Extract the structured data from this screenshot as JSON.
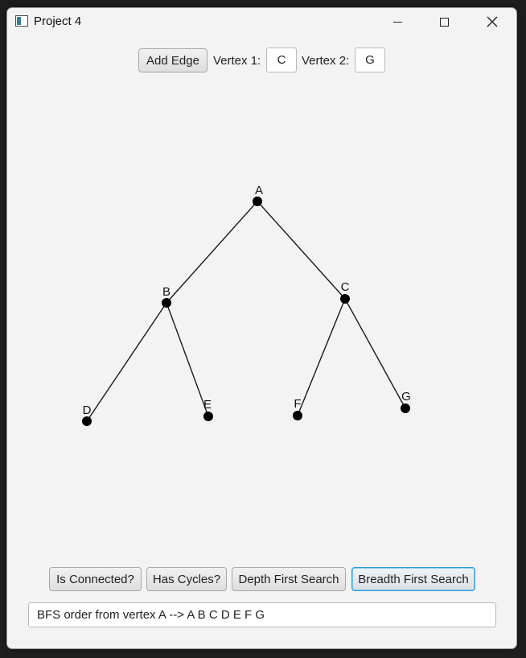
{
  "window": {
    "title": "Project 4"
  },
  "toolbar": {
    "add_edge_label": "Add Edge",
    "vertex1_label": "Vertex 1:",
    "vertex1_value": "C",
    "vertex2_label": "Vertex 2:",
    "vertex2_value": "G"
  },
  "graph": {
    "vertices": [
      {
        "id": "A"
      },
      {
        "id": "B"
      },
      {
        "id": "C"
      },
      {
        "id": "D"
      },
      {
        "id": "E"
      },
      {
        "id": "F"
      },
      {
        "id": "G"
      }
    ],
    "edges": [
      [
        "A",
        "B"
      ],
      [
        "A",
        "C"
      ],
      [
        "B",
        "D"
      ],
      [
        "B",
        "E"
      ],
      [
        "C",
        "F"
      ],
      [
        "C",
        "G"
      ]
    ]
  },
  "actions": {
    "is_connected_label": "Is Connected?",
    "has_cycles_label": "Has Cycles?",
    "dfs_label": "Depth First Search",
    "bfs_label": "Breadth First Search"
  },
  "result": {
    "text": "BFS order from vertex A --> A B C D E F G"
  },
  "colors": {
    "focus_accent": "#2f9bd8",
    "window_bg": "#f3f3f3",
    "vertex": "#000000"
  }
}
